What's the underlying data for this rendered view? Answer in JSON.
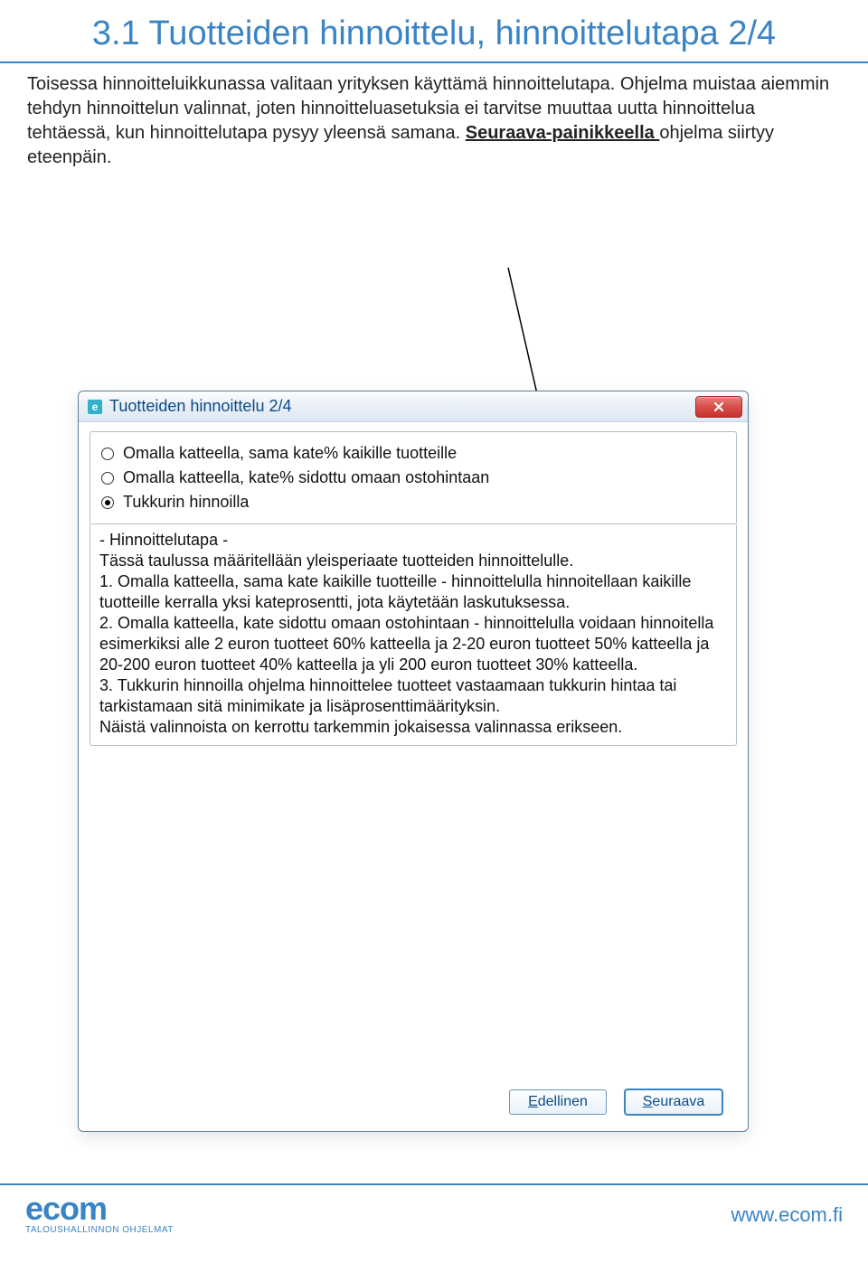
{
  "page": {
    "title": "3.1 Tuotteiden hinnoittelu, hinnoittelutapa 2/4",
    "intro_part1": "Toisessa hinnoitteluikkunassa valitaan  yrityksen käyttämä hinnoittelutapa. Ohjelma muistaa aiemmin tehdyn hinnoittelun valinnat, joten hinnoitteluasetuksia ei tarvitse muuttaa uutta hinnoittelua tehtäessä, kun hinnoittelutapa pysyy yleensä samana. ",
    "intro_link": "Seuraava-painikkeella ",
    "intro_part2": "ohjelma siirtyy eteenpäin."
  },
  "dialog": {
    "favicon_letter": "e",
    "title": "Tuotteiden hinnoittelu 2/4",
    "options": [
      {
        "label": "Omalla katteella, sama kate% kaikille tuotteille",
        "selected": false
      },
      {
        "label": "Omalla katteella, kate% sidottu omaan ostohintaan",
        "selected": false
      },
      {
        "label": "Tukkurin hinnoilla",
        "selected": true
      }
    ],
    "description": {
      "heading": "- Hinnoittelutapa -",
      "line0": "Tässä taulussa määritellään yleisperiaate tuotteiden hinnoittelulle.",
      "line1": "1. Omalla katteella, sama kate kaikille tuotteille - hinnoittelulla hinnoitellaan kaikille tuotteille kerralla yksi kateprosentti, jota käytetään laskutuksessa.",
      "line2": "2. Omalla katteella, kate sidottu omaan ostohintaan - hinnoittelulla voidaan hinnoitella esimerkiksi alle 2 euron tuotteet 60% katteella ja 2-20 euron tuotteet 50% katteella ja 20-200 euron tuotteet 40% katteella ja yli 200 euron tuotteet 30% katteella.",
      "line3": "3. Tukkurin hinnoilla ohjelma hinnoittelee tuotteet vastaamaan tukkurin hintaa tai tarkistamaan sitä minimikate ja lisäprosenttimäärityksin.",
      "line4": "Näistä valinnoista on kerrottu tarkemmin jokaisessa valinnassa erikseen."
    },
    "buttons": {
      "prev_ul": "E",
      "prev_rest": "dellinen",
      "next_ul": "S",
      "next_rest": "euraava"
    }
  },
  "footer": {
    "logo_word": "ecom",
    "logo_tag": "TALOUSHALLINNON OHJELMAT",
    "url": "www.ecom.fi"
  }
}
